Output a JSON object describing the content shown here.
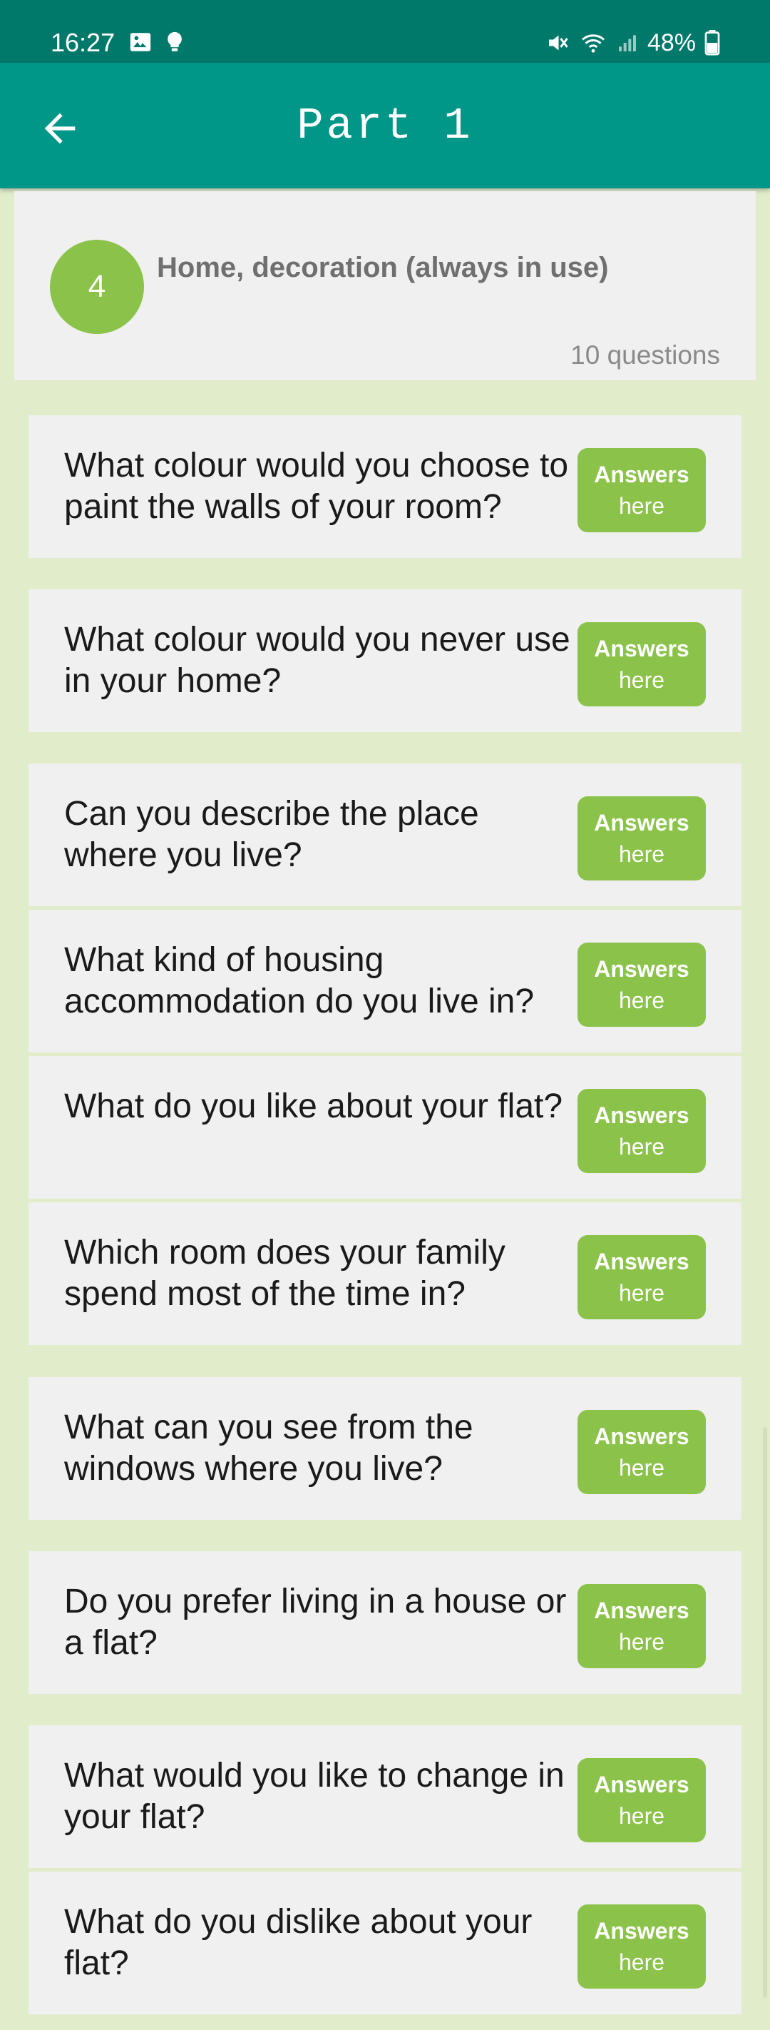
{
  "status_bar": {
    "time": "16:27",
    "battery": "48%"
  },
  "appbar": {
    "title": "Part 1"
  },
  "topic": {
    "number": "4",
    "title": "Home, decoration (always in use)",
    "count": "10 questions"
  },
  "questions": [
    {
      "text": "What colour would you choose to paint the walls of your room?",
      "btn_top": "Answers",
      "btn_bottom": "here"
    },
    {
      "text": "What colour would you never use in your home?",
      "btn_top": "Answers",
      "btn_bottom": "here"
    },
    {
      "text": "Can you describe the place where you live?",
      "btn_top": "Answers",
      "btn_bottom": "here"
    },
    {
      "text": "What kind of housing accommodation do you live in?",
      "btn_top": "Answers",
      "btn_bottom": "here"
    },
    {
      "text": "What do you like about your flat?",
      "btn_top": "Answers",
      "btn_bottom": "here"
    },
    {
      "text": "Which room does your family spend most of the time in?",
      "btn_top": "Answers",
      "btn_bottom": "here"
    },
    {
      "text": "What can you see from the windows where you live?",
      "btn_top": "Answers",
      "btn_bottom": "here"
    },
    {
      "text": "Do you prefer living in a house or a flat?",
      "btn_top": "Answers",
      "btn_bottom": "here"
    },
    {
      "text": "What would you like to change in your flat?",
      "btn_top": "Answers",
      "btn_bottom": "here"
    },
    {
      "text": "What do you dislike about your flat?",
      "btn_top": "Answers",
      "btn_bottom": "here"
    }
  ],
  "colors": {
    "statusbar": "#00796b",
    "appbar": "#009688",
    "accent": "#8bc34a",
    "background": "#e0ecca",
    "card": "#f0f0f0"
  }
}
